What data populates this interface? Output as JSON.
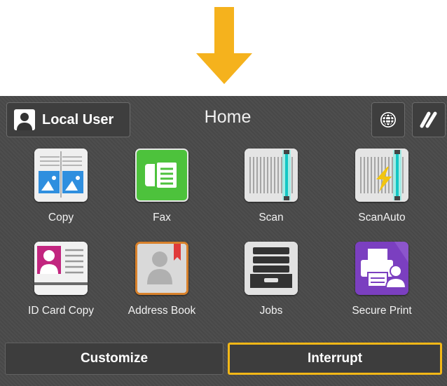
{
  "colors": {
    "accent_arrow": "#f5b21d",
    "panel_bg": "#4a4a4a",
    "highlight_border": "#f3b717",
    "fax_green": "#4dc23c",
    "secure_print_purple": "#7b3fc0",
    "id_card_magenta": "#c2257f"
  },
  "header": {
    "user_label": "Local User",
    "title": "Home",
    "language_icon": "globe-icon",
    "logout_icon": "double-slash-icon"
  },
  "apps": [
    {
      "label": "Copy",
      "icon": "copy-icon"
    },
    {
      "label": "Fax",
      "icon": "fax-icon"
    },
    {
      "label": "Scan",
      "icon": "scan-icon"
    },
    {
      "label": "ScanAuto",
      "icon": "scanauto-icon"
    },
    {
      "label": "ID Card Copy",
      "icon": "id-card-icon"
    },
    {
      "label": "Address Book",
      "icon": "address-book-icon"
    },
    {
      "label": "Jobs",
      "icon": "jobs-icon"
    },
    {
      "label": "Secure Print",
      "icon": "secure-print-icon"
    }
  ],
  "footer": {
    "customize_label": "Customize",
    "interrupt_label": "Interrupt"
  }
}
